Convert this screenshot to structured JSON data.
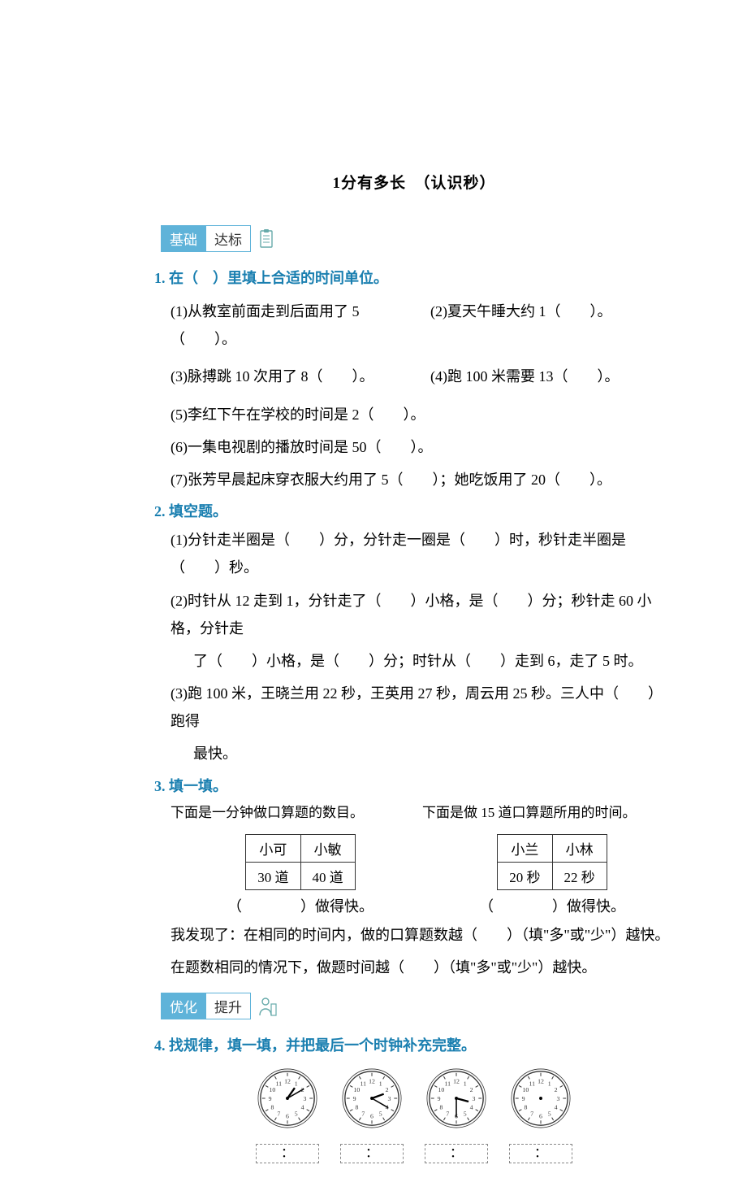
{
  "title": "1分有多长　（认识秒）",
  "badge1_left": "基础",
  "badge1_right": "达标",
  "q1_head": "1. 在（　）里填上合适的时间单位。",
  "q1_1": "(1)从教室前面走到后面用了 5（　　）。",
  "q1_2": "(2)夏天午睡大约 1（　　）。",
  "q1_3": "(3)脉搏跳 10 次用了 8（　　）。",
  "q1_4": "(4)跑 100 米需要 13（　　）。",
  "q1_5": "(5)李红下午在学校的时间是 2（　　）。",
  "q1_6": "(6)一集电视剧的播放时间是 50（　　）。",
  "q1_7": "(7)张芳早晨起床穿衣服大约用了 5（　　）；她吃饭用了 20（　　）。",
  "q2_head": "2. 填空题。",
  "q2_1": "(1)分针走半圈是（　　）分，分针走一圈是（　　）时，秒针走半圈是（　　）秒。",
  "q2_2a": "(2)时针从 12 走到 1，分针走了（　　）小格，是（　　）分；秒针走 60 小格，分针走",
  "q2_2b": "了（　　）小格，是（　　）分；时针从（　　）走到 6，走了 5 时。",
  "q2_3a": "(3)跑 100 米，王晓兰用 22 秒，王英用 27 秒，周云用 25 秒。三人中（　　）跑得",
  "q2_3b": "最快。",
  "q3_head": "3. 填一填。",
  "q3_intro1": "下面是一分钟做口算题的数目。",
  "q3_intro2": "下面是做 15 道口算题所用的时间。",
  "t1_h1": "小可",
  "t1_h2": "小敏",
  "t1_v1": "30 道",
  "t1_v2": "40 道",
  "t1_under": "（　　　　）做得快。",
  "t2_h1": "小兰",
  "t2_h2": "小林",
  "t2_v1": "20 秒",
  "t2_v2": "22 秒",
  "t2_under": "（　　　　）做得快。",
  "q3_find1": "我发现了：在相同的时间内，做的口算题数越（　　）（填\"多\"或\"少\"）越快。",
  "q3_find2": "在题数相同的情况下，做题时间越（　　）（填\"多\"或\"少\"）越快。",
  "badge2_left": "优化",
  "badge2_right": "提升",
  "q4_head": "4. 找规律，填一填，并把最后一个时钟补充完整。",
  "timebox_sep": "：",
  "clocks": [
    {
      "hour": 1,
      "minute": 10,
      "showHands": true
    },
    {
      "hour": 2,
      "minute": 20,
      "showHands": true
    },
    {
      "hour": 3,
      "minute": 30,
      "showHands": true
    },
    {
      "hour": 0,
      "minute": 0,
      "showHands": false
    }
  ]
}
